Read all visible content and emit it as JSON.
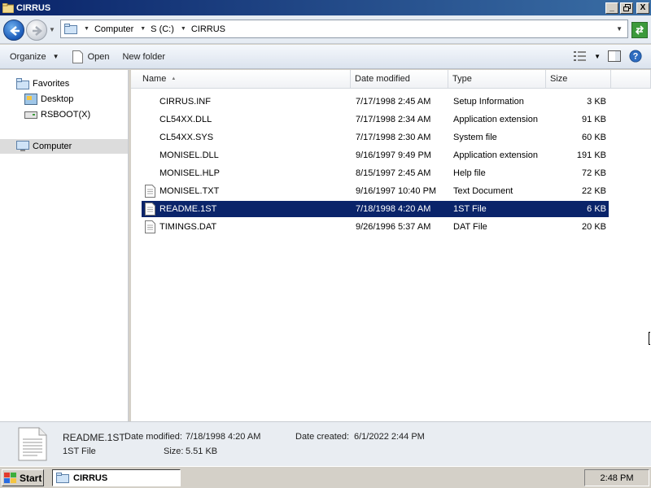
{
  "window": {
    "title": "CIRRUS",
    "controls": [
      "_",
      "□",
      "X"
    ]
  },
  "address": {
    "crumbs": [
      "Computer",
      "S (C:)",
      "CIRRUS"
    ]
  },
  "toolbar": {
    "organize_label": "Organize",
    "open_label": "Open",
    "new_folder_label": "New folder"
  },
  "nav": {
    "favorites": "Favorites",
    "desktop": "Desktop",
    "rsboot": "RSBOOT(X)",
    "computer": "Computer"
  },
  "columns": {
    "name": "Name",
    "date": "Date modified",
    "type": "Type",
    "size": "Size"
  },
  "files": [
    {
      "name": "CIRRUS.INF",
      "date": "7/17/1998 2:45 AM",
      "type": "Setup Information",
      "size": "3 KB",
      "icon": "none"
    },
    {
      "name": "CL54XX.DLL",
      "date": "7/17/1998 2:34 AM",
      "type": "Application extension",
      "size": "91 KB",
      "icon": "none"
    },
    {
      "name": "CL54XX.SYS",
      "date": "7/17/1998 2:30 AM",
      "type": "System file",
      "size": "60 KB",
      "icon": "none"
    },
    {
      "name": "MONISEL.DLL",
      "date": "9/16/1997 9:49 PM",
      "type": "Application extension",
      "size": "191 KB",
      "icon": "none"
    },
    {
      "name": "MONISEL.HLP",
      "date": "8/15/1997 2:45 AM",
      "type": "Help file",
      "size": "72 KB",
      "icon": "none"
    },
    {
      "name": "MONISEL.TXT",
      "date": "9/16/1997 10:40 PM",
      "type": "Text Document",
      "size": "22 KB",
      "icon": "text-document-icon"
    },
    {
      "name": "README.1ST",
      "date": "7/18/1998 4:20 AM",
      "type": "1ST File",
      "size": "6 KB",
      "icon": "document-icon"
    },
    {
      "name": "TIMINGS.DAT",
      "date": "9/26/1996 5:37 AM",
      "type": "DAT File",
      "size": "20 KB",
      "icon": "document-icon"
    }
  ],
  "details": {
    "name": "README.1ST",
    "type": "1ST File",
    "date_modified_label": "Date modified:",
    "date_modified": "7/18/1998 4:20 AM",
    "size_label": "Size:",
    "size": "5.51 KB",
    "date_created_label": "Date created:",
    "date_created": "6/1/2022 2:44 PM"
  },
  "taskbar": {
    "start_label": "Start",
    "task_label": "CIRRUS",
    "clock": "2:48 PM"
  },
  "colors": {
    "selection": "#0a246a",
    "titlebar": "#0a246a"
  }
}
